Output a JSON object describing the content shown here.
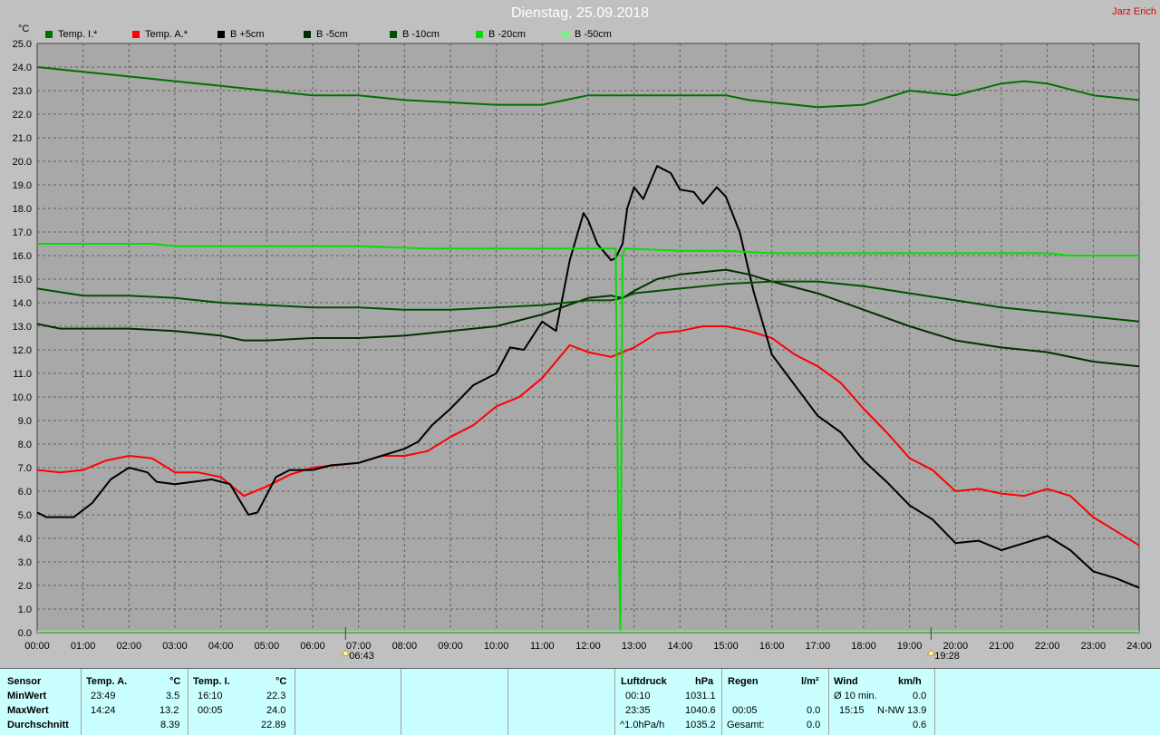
{
  "title": "Dienstag, 25.09.2018",
  "author": "Jarz Erich",
  "unit": "°C",
  "legend": [
    {
      "label": "Temp. I.*",
      "color": "#007000"
    },
    {
      "label": "Temp. A.*",
      "color": "#ff0000"
    },
    {
      "label": "B +5cm",
      "color": "#000000"
    },
    {
      "label": "B -5cm",
      "color": "#003000"
    },
    {
      "label": "B -10cm",
      "color": "#005000"
    },
    {
      "label": "B -20cm",
      "color": "#00e000"
    },
    {
      "label": "B -50cm",
      "color": "#80f080"
    }
  ],
  "sun_markers": {
    "sunrise": "06:43",
    "sunset": "19:28"
  },
  "chart_data": {
    "type": "line",
    "title": "Dienstag, 25.09.2018",
    "ylabel": "°C",
    "ylim": [
      0,
      25
    ],
    "xlim": [
      0,
      24
    ],
    "grid": true,
    "legend_position": "top",
    "x_tick_labels": [
      "00:00",
      "01:00",
      "02:00",
      "03:00",
      "04:00",
      "05:00",
      "06:00",
      "07:00",
      "08:00",
      "09:00",
      "10:00",
      "11:00",
      "12:00",
      "13:00",
      "14:00",
      "15:00",
      "16:00",
      "17:00",
      "18:00",
      "19:00",
      "20:00",
      "21:00",
      "22:00",
      "23:00",
      "24:00"
    ],
    "y_tick_labels": [
      "0.0",
      "1.0",
      "2.0",
      "3.0",
      "4.0",
      "5.0",
      "6.0",
      "7.0",
      "8.0",
      "9.0",
      "10.0",
      "11.0",
      "12.0",
      "13.0",
      "14.0",
      "15.0",
      "16.0",
      "17.0",
      "18.0",
      "19.0",
      "20.0",
      "21.0",
      "22.0",
      "23.0",
      "24.0",
      "25.0"
    ],
    "series": [
      {
        "name": "Temp. I.*",
        "color": "#007000",
        "points": [
          [
            0,
            24.0
          ],
          [
            1,
            23.8
          ],
          [
            2,
            23.6
          ],
          [
            3,
            23.4
          ],
          [
            4,
            23.2
          ],
          [
            5,
            23.0
          ],
          [
            6,
            22.8
          ],
          [
            7,
            22.8
          ],
          [
            8,
            22.6
          ],
          [
            9,
            22.5
          ],
          [
            10,
            22.4
          ],
          [
            11,
            22.4
          ],
          [
            12,
            22.8
          ],
          [
            13,
            22.8
          ],
          [
            14,
            22.8
          ],
          [
            15,
            22.8
          ],
          [
            15.5,
            22.6
          ],
          [
            16,
            22.5
          ],
          [
            17,
            22.3
          ],
          [
            18,
            22.4
          ],
          [
            19,
            23.0
          ],
          [
            20,
            22.8
          ],
          [
            21,
            23.3
          ],
          [
            21.5,
            23.4
          ],
          [
            22,
            23.3
          ],
          [
            23,
            22.8
          ],
          [
            24,
            22.6
          ]
        ]
      },
      {
        "name": "Temp. A.*",
        "color": "#ff0000",
        "points": [
          [
            0,
            6.9
          ],
          [
            0.5,
            6.8
          ],
          [
            1,
            6.9
          ],
          [
            1.5,
            7.3
          ],
          [
            2,
            7.5
          ],
          [
            2.5,
            7.4
          ],
          [
            3,
            6.8
          ],
          [
            3.5,
            6.8
          ],
          [
            4,
            6.6
          ],
          [
            4.5,
            5.8
          ],
          [
            5,
            6.2
          ],
          [
            5.5,
            6.7
          ],
          [
            6,
            7.0
          ],
          [
            6.5,
            7.1
          ],
          [
            7,
            7.2
          ],
          [
            7.5,
            7.5
          ],
          [
            8,
            7.5
          ],
          [
            8.5,
            7.7
          ],
          [
            9,
            8.3
          ],
          [
            9.5,
            8.8
          ],
          [
            10,
            9.6
          ],
          [
            10.5,
            10.0
          ],
          [
            11,
            10.8
          ],
          [
            11.3,
            11.5
          ],
          [
            11.6,
            12.2
          ],
          [
            12,
            11.9
          ],
          [
            12.5,
            11.7
          ],
          [
            13,
            12.1
          ],
          [
            13.5,
            12.7
          ],
          [
            14,
            12.8
          ],
          [
            14.5,
            13.0
          ],
          [
            15,
            13.0
          ],
          [
            15.5,
            12.8
          ],
          [
            16,
            12.5
          ],
          [
            16.5,
            11.8
          ],
          [
            17,
            11.3
          ],
          [
            17.5,
            10.6
          ],
          [
            18,
            9.5
          ],
          [
            18.5,
            8.5
          ],
          [
            19,
            7.4
          ],
          [
            19.5,
            6.9
          ],
          [
            20,
            6.0
          ],
          [
            20.5,
            6.1
          ],
          [
            21,
            5.9
          ],
          [
            21.5,
            5.8
          ],
          [
            22,
            6.1
          ],
          [
            22.5,
            5.8
          ],
          [
            23,
            4.9
          ],
          [
            23.5,
            4.3
          ],
          [
            24,
            3.7
          ]
        ]
      },
      {
        "name": "B +5cm",
        "color": "#000000",
        "points": [
          [
            0,
            5.1
          ],
          [
            0.2,
            4.9
          ],
          [
            0.8,
            4.9
          ],
          [
            1.2,
            5.5
          ],
          [
            1.6,
            6.5
          ],
          [
            2,
            7.0
          ],
          [
            2.4,
            6.8
          ],
          [
            2.6,
            6.4
          ],
          [
            3,
            6.3
          ],
          [
            3.4,
            6.4
          ],
          [
            3.8,
            6.5
          ],
          [
            4.2,
            6.3
          ],
          [
            4.6,
            5.0
          ],
          [
            4.8,
            5.1
          ],
          [
            5.2,
            6.6
          ],
          [
            5.5,
            6.9
          ],
          [
            6,
            6.9
          ],
          [
            6.4,
            7.1
          ],
          [
            7,
            7.2
          ],
          [
            7.5,
            7.5
          ],
          [
            8,
            7.8
          ],
          [
            8.3,
            8.1
          ],
          [
            8.6,
            8.8
          ],
          [
            9,
            9.5
          ],
          [
            9.5,
            10.5
          ],
          [
            10,
            11.0
          ],
          [
            10.3,
            12.1
          ],
          [
            10.6,
            12.0
          ],
          [
            11,
            13.2
          ],
          [
            11.3,
            12.8
          ],
          [
            11.6,
            15.8
          ],
          [
            11.9,
            17.8
          ],
          [
            12.0,
            17.5
          ],
          [
            12.2,
            16.5
          ],
          [
            12.5,
            15.8
          ],
          [
            12.6,
            15.9
          ],
          [
            12.75,
            16.5
          ],
          [
            12.85,
            18.0
          ],
          [
            13,
            18.9
          ],
          [
            13.2,
            18.4
          ],
          [
            13.5,
            19.8
          ],
          [
            13.8,
            19.5
          ],
          [
            14,
            18.8
          ],
          [
            14.3,
            18.7
          ],
          [
            14.5,
            18.2
          ],
          [
            14.8,
            18.9
          ],
          [
            15,
            18.5
          ],
          [
            15.3,
            17.0
          ],
          [
            15.6,
            14.5
          ],
          [
            16,
            11.8
          ],
          [
            16.5,
            10.5
          ],
          [
            17,
            9.2
          ],
          [
            17.5,
            8.5
          ],
          [
            18,
            7.3
          ],
          [
            18.5,
            6.4
          ],
          [
            19,
            5.4
          ],
          [
            19.5,
            4.8
          ],
          [
            20,
            3.8
          ],
          [
            20.5,
            3.9
          ],
          [
            21,
            3.5
          ],
          [
            21.5,
            3.8
          ],
          [
            22,
            4.1
          ],
          [
            22.5,
            3.5
          ],
          [
            23,
            2.6
          ],
          [
            23.5,
            2.3
          ],
          [
            24,
            1.9
          ]
        ]
      },
      {
        "name": "B -5cm",
        "color": "#003000",
        "points": [
          [
            0,
            13.1
          ],
          [
            0.5,
            12.9
          ],
          [
            1,
            12.9
          ],
          [
            2,
            12.9
          ],
          [
            3,
            12.8
          ],
          [
            4,
            12.6
          ],
          [
            4.5,
            12.4
          ],
          [
            5,
            12.4
          ],
          [
            6,
            12.5
          ],
          [
            7,
            12.5
          ],
          [
            8,
            12.6
          ],
          [
            9,
            12.8
          ],
          [
            10,
            13.0
          ],
          [
            11,
            13.5
          ],
          [
            12,
            14.2
          ],
          [
            12.5,
            14.3
          ],
          [
            12.75,
            14.2
          ],
          [
            13,
            14.5
          ],
          [
            13.5,
            15.0
          ],
          [
            14,
            15.2
          ],
          [
            14.5,
            15.3
          ],
          [
            15,
            15.4
          ],
          [
            15.5,
            15.2
          ],
          [
            16,
            14.9
          ],
          [
            17,
            14.4
          ],
          [
            18,
            13.7
          ],
          [
            19,
            13.0
          ],
          [
            20,
            12.4
          ],
          [
            21,
            12.1
          ],
          [
            22,
            11.9
          ],
          [
            23,
            11.5
          ],
          [
            24,
            11.3
          ]
        ]
      },
      {
        "name": "B -10cm",
        "color": "#005000",
        "points": [
          [
            0,
            14.6
          ],
          [
            1,
            14.3
          ],
          [
            2,
            14.3
          ],
          [
            3,
            14.2
          ],
          [
            4,
            14.0
          ],
          [
            5,
            13.9
          ],
          [
            6,
            13.8
          ],
          [
            7,
            13.8
          ],
          [
            8,
            13.7
          ],
          [
            9,
            13.7
          ],
          [
            10,
            13.8
          ],
          [
            11,
            13.9
          ],
          [
            12,
            14.1
          ],
          [
            12.5,
            14.1
          ],
          [
            12.75,
            14.2
          ],
          [
            13,
            14.4
          ],
          [
            14,
            14.6
          ],
          [
            15,
            14.8
          ],
          [
            16,
            14.9
          ],
          [
            17,
            14.9
          ],
          [
            18,
            14.7
          ],
          [
            19,
            14.4
          ],
          [
            20,
            14.1
          ],
          [
            21,
            13.8
          ],
          [
            22,
            13.6
          ],
          [
            23,
            13.4
          ],
          [
            24,
            13.2
          ]
        ]
      },
      {
        "name": "B -20cm",
        "color": "#00e000",
        "points": [
          [
            0,
            16.5
          ],
          [
            2.5,
            16.5
          ],
          [
            3,
            16.4
          ],
          [
            5,
            16.4
          ],
          [
            7,
            16.4
          ],
          [
            8.5,
            16.3
          ],
          [
            10,
            16.3
          ],
          [
            12,
            16.3
          ],
          [
            12.6,
            16.3
          ],
          [
            12.65,
            6.0
          ],
          [
            12.7,
            0.1
          ],
          [
            12.75,
            16.0
          ],
          [
            12.8,
            16.3
          ],
          [
            14,
            16.2
          ],
          [
            15,
            16.2
          ],
          [
            16,
            16.1
          ],
          [
            18,
            16.1
          ],
          [
            20,
            16.1
          ],
          [
            22,
            16.1
          ],
          [
            22.5,
            16.0
          ],
          [
            24,
            16.0
          ]
        ]
      },
      {
        "name": "B -50cm",
        "color": "#80f080",
        "points": [
          [
            0,
            0.05
          ],
          [
            24,
            0.05
          ]
        ]
      }
    ]
  },
  "stats": {
    "sensor_header": "Sensor",
    "rows": [
      "MinWert",
      "MaxWert",
      "Durchschnitt"
    ],
    "temp_a": {
      "header": "Temp. A.",
      "unit": "°C",
      "min_time": "23:49",
      "min": "3.5",
      "max_time": "14:24",
      "max": "13.2",
      "avg": "8.39"
    },
    "temp_i": {
      "header": "Temp. I.",
      "unit": "°C",
      "min_time": "16:10",
      "min": "22.3",
      "max_time": "00:05",
      "max": "24.0",
      "avg": "22.89"
    },
    "pressure": {
      "header": "Luftdruck",
      "unit": "hPa",
      "min_time": "00:10",
      "min": "1031.1",
      "max_time": "23:35",
      "max": "1040.6",
      "trend_label": "^1.0hPa/h",
      "trend_value": "1035.2"
    },
    "rain": {
      "header": "Regen",
      "unit": "l/m²",
      "max_time": "00:05",
      "max": "0.0",
      "total_label": "Gesamt:",
      "total": "0.0"
    },
    "wind": {
      "header": "Wind",
      "unit": "km/h",
      "avg_label": "Ø 10 min.",
      "avg": "0.0",
      "max_time": "15:15",
      "max_dir": "N-NW",
      "max": "13.9",
      "avg2": "0.6"
    }
  }
}
